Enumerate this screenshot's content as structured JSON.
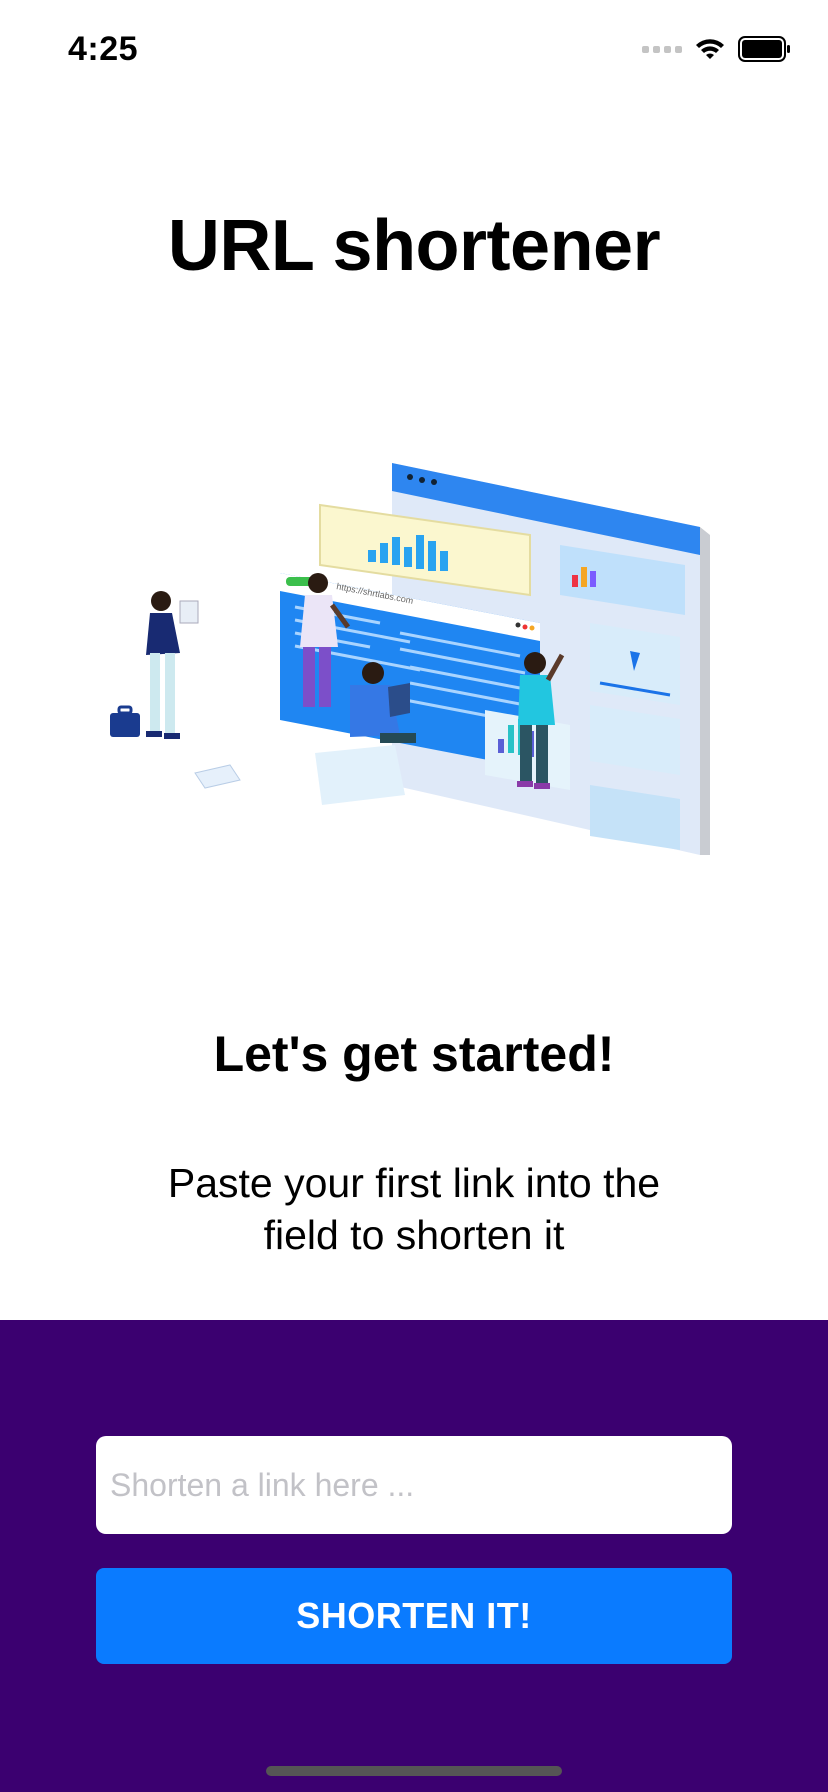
{
  "status_bar": {
    "time": "4:25",
    "icons": [
      "signal-icon",
      "wifi-icon",
      "battery-icon"
    ]
  },
  "title": "URL shortener",
  "illustration": {
    "description": "isometric-people-analytics-dashboard",
    "url_bar_text": "https://shrtlabs.com"
  },
  "heading": "Let's get started!",
  "subtitle": "Paste your first link into the field to shorten it",
  "form": {
    "input_placeholder": "Shorten a link here ...",
    "input_value": "",
    "button_label": "SHORTEN IT!"
  },
  "colors": {
    "panel_background": "#3b0070",
    "button_background": "#0a7bff",
    "button_text": "#ffffff"
  }
}
